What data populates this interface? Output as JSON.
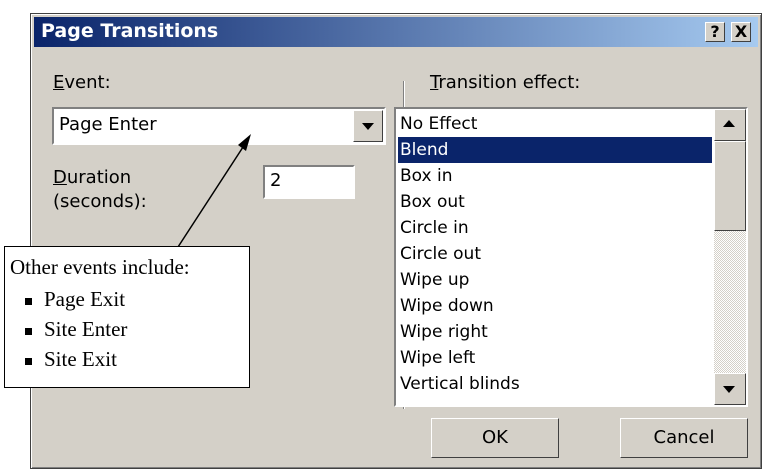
{
  "dialog": {
    "title": "Page Transitions",
    "help_button": "?",
    "close_button": "X"
  },
  "event": {
    "label_first": "E",
    "label_rest": "vent:",
    "value": "Page Enter"
  },
  "duration": {
    "label_first": "D",
    "label_rest": "uration",
    "label_line2": "(seconds):",
    "value": "2"
  },
  "transition": {
    "label_first": "T",
    "label_rest": "ransition effect:",
    "items": [
      "No Effect",
      "Blend",
      "Box in",
      "Box out",
      "Circle in",
      "Circle out",
      "Wipe up",
      "Wipe down",
      "Wipe right",
      "Wipe left",
      "Vertical blinds"
    ],
    "selected_index": 1
  },
  "buttons": {
    "ok": "OK",
    "cancel": "Cancel"
  },
  "callout": {
    "heading": "Other events include:",
    "items": [
      "Page Exit",
      "Site Enter",
      "Site Exit"
    ]
  }
}
